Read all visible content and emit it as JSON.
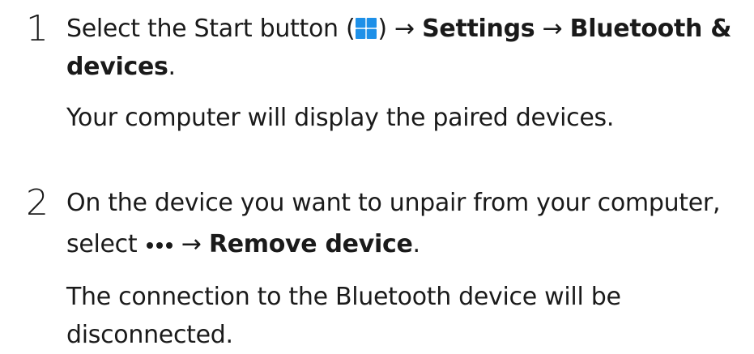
{
  "steps": [
    {
      "number": "1",
      "instruction": {
        "prefix": "Select the Start button (",
        "icon_start": "windows-start-icon",
        "after_icon": ") ",
        "arrow1": "→",
        "bold1": "Settings",
        "arrow2": "→",
        "bold2_line1": "Bluetooth &",
        "bold2_line2": "devices",
        "end": "."
      },
      "result": "Your computer will display the paired devices."
    },
    {
      "number": "2",
      "instruction": {
        "line1": "On the device you want to unpair from your computer,",
        "select_word": "select",
        "icon_more": "more-options-icon",
        "arrow": "→",
        "bold": "Remove device",
        "end": "."
      },
      "result_line1": "The connection to the Bluetooth device will be",
      "result_line2": "disconnected."
    }
  ],
  "colors": {
    "text": "#1a1a1a",
    "start_icon_blue": "#1e90e8"
  }
}
